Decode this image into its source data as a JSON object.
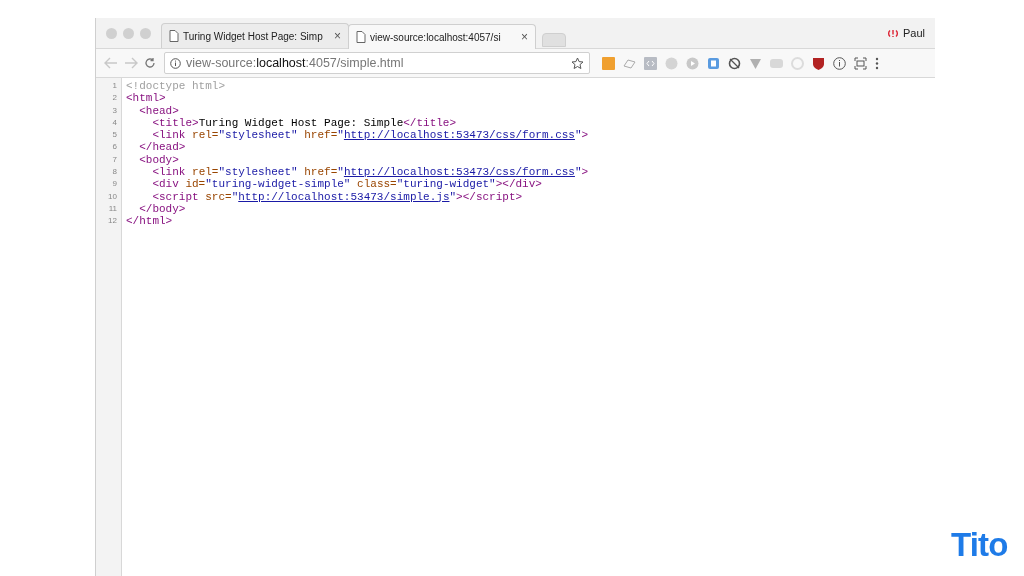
{
  "tabs": [
    {
      "title": "Turing Widget Host Page: Simp",
      "selected": false,
      "close": "×"
    },
    {
      "title": "view-source:localhost:4057/si",
      "selected": true,
      "close": "×"
    }
  ],
  "profile": {
    "name": "Paul"
  },
  "address_bar": {
    "scheme": "view-source:",
    "host": "localhost",
    "path": ":4057/simple.html"
  },
  "source_lines": [
    {
      "number": "1",
      "tokens": [
        {
          "kind": "doctype",
          "text": "<!doctype html>"
        }
      ]
    },
    {
      "number": "2",
      "tokens": [
        {
          "kind": "tag",
          "text": "<html>"
        }
      ]
    },
    {
      "number": "3",
      "tokens": [
        {
          "kind": "tag",
          "text": "  <head>"
        }
      ]
    },
    {
      "number": "4",
      "tokens": [
        {
          "kind": "tag",
          "text": "    <title>"
        },
        {
          "kind": "text",
          "text": "Turing Widget Host Page: Simple"
        },
        {
          "kind": "tag",
          "text": "</title>"
        }
      ]
    },
    {
      "number": "5",
      "tokens": [
        {
          "kind": "tag",
          "text": "    <link"
        },
        {
          "kind": "attr",
          "text": " rel="
        },
        {
          "kind": "value",
          "text": "\"stylesheet\""
        },
        {
          "kind": "attr",
          "text": " href="
        },
        {
          "kind": "value",
          "text": "\""
        },
        {
          "kind": "link",
          "text": "http://localhost:53473/css/form.css"
        },
        {
          "kind": "value",
          "text": "\""
        },
        {
          "kind": "tag",
          "text": ">"
        }
      ]
    },
    {
      "number": "6",
      "tokens": [
        {
          "kind": "tag",
          "text": "  </head>"
        }
      ]
    },
    {
      "number": "7",
      "tokens": [
        {
          "kind": "tag",
          "text": "  <body>"
        }
      ]
    },
    {
      "number": "8",
      "tokens": [
        {
          "kind": "tag",
          "text": "    <link"
        },
        {
          "kind": "attr",
          "text": " rel="
        },
        {
          "kind": "value",
          "text": "\"stylesheet\""
        },
        {
          "kind": "attr",
          "text": " href="
        },
        {
          "kind": "value",
          "text": "\""
        },
        {
          "kind": "link",
          "text": "http://localhost:53473/css/form.css"
        },
        {
          "kind": "value",
          "text": "\""
        },
        {
          "kind": "tag",
          "text": ">"
        }
      ]
    },
    {
      "number": "9",
      "tokens": [
        {
          "kind": "tag",
          "text": "    <div"
        },
        {
          "kind": "attr",
          "text": " id="
        },
        {
          "kind": "value",
          "text": "\"turing-widget-simple\""
        },
        {
          "kind": "attr",
          "text": " class="
        },
        {
          "kind": "value",
          "text": "\"turing-widget\""
        },
        {
          "kind": "tag",
          "text": "></div>"
        }
      ]
    },
    {
      "number": "10",
      "tokens": [
        {
          "kind": "tag",
          "text": "    <script"
        },
        {
          "kind": "attr",
          "text": " src="
        },
        {
          "kind": "value",
          "text": "\""
        },
        {
          "kind": "link",
          "text": "http://localhost:53473/simple.js"
        },
        {
          "kind": "value",
          "text": "\""
        },
        {
          "kind": "tag",
          "text": "></script>"
        }
      ]
    },
    {
      "number": "11",
      "tokens": [
        {
          "kind": "tag",
          "text": "  </body>"
        }
      ]
    },
    {
      "number": "12",
      "tokens": [
        {
          "kind": "tag",
          "text": "</html>"
        }
      ]
    }
  ],
  "slide_logo": {
    "text": "Tito"
  }
}
